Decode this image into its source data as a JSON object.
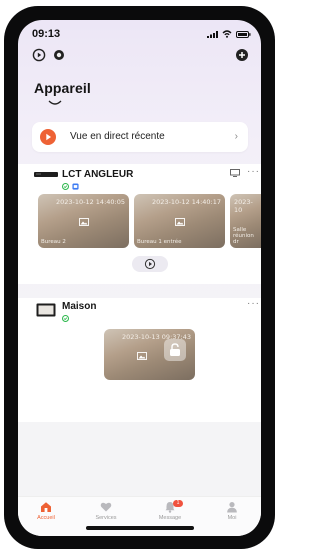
{
  "status": {
    "time": "09:13"
  },
  "page": {
    "title": "Appareil"
  },
  "recent": {
    "label": "Vue en direct récente",
    "chevron": "›"
  },
  "devices": [
    {
      "name": "LCT ANGLEUR",
      "thumbnails": [
        {
          "timestamp": "2023-10-12 14:40:05",
          "caption": "Bureau 2"
        },
        {
          "timestamp": "2023-10-12 14:40:17",
          "caption": "Bureau 1 entrée"
        },
        {
          "timestamp": "2023-10",
          "caption": "Salle réunion dr"
        }
      ]
    },
    {
      "name": "Maison",
      "thumbnails": [
        {
          "timestamp": "2023-10-13 09:37:43",
          "caption": ""
        }
      ]
    }
  ],
  "more_glyph": "···",
  "tabs": [
    {
      "label": "Accueil",
      "icon": "home-icon",
      "active": true
    },
    {
      "label": "Services",
      "icon": "heart-icon"
    },
    {
      "label": "Message",
      "icon": "bell-icon",
      "badge": "1"
    },
    {
      "label": "Moi",
      "icon": "person-icon"
    }
  ],
  "colors": {
    "accent": "#ee6235",
    "online": "#2db84d",
    "info": "#3d7bf2"
  }
}
